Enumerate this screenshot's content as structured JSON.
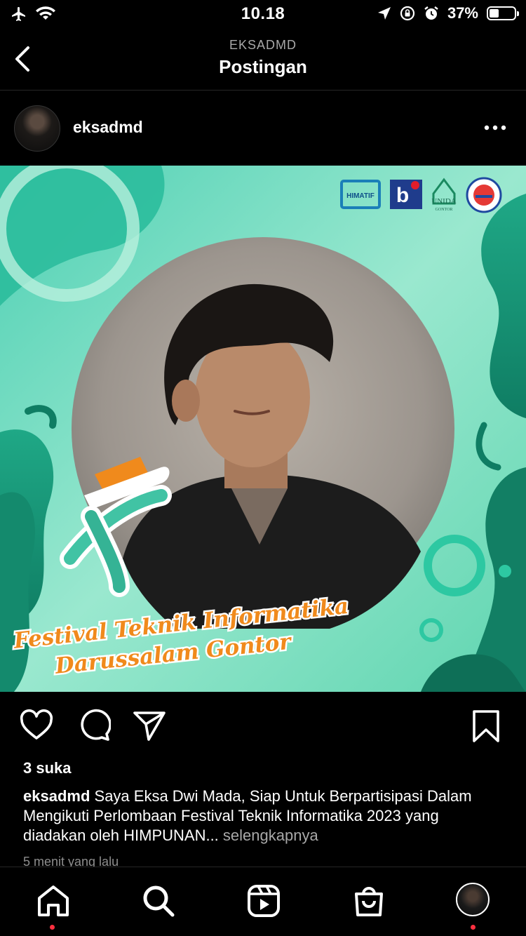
{
  "status_bar": {
    "time": "10.18",
    "battery_text": "37%",
    "icons": [
      "airplane-icon",
      "wifi-icon",
      "location-arrow-icon",
      "rotation-lock-icon",
      "alarm-icon",
      "battery-icon"
    ],
    "battery_level": 0.37
  },
  "header": {
    "subtitle": "EKSADMD",
    "title": "Postingan"
  },
  "post": {
    "username": "eksadmd",
    "image_text": {
      "logo_label": "HIMATIF",
      "unida_label": "UNIDA",
      "unida_sub": "GONTOR",
      "festival_line1": "Festival Teknik Informatika",
      "festival_line2": "Darussalam Gontor"
    },
    "likes": "3 suka",
    "caption_user": "eksadmd",
    "caption_text": "Saya Eksa Dwi Mada, Siap Untuk Berpartisipasi Dalam Mengikuti Perlombaan Festival Teknik Informatika 2023 yang diadakan oleh HIMPUNAN...",
    "more_label": "selengkapnya",
    "time_ago": "5 menit yang lalu"
  },
  "colors": {
    "background": "#000000",
    "muted": "#a8a8a8",
    "teal": "#2fb89a",
    "orange": "#f08a1c",
    "notification": "#ff3040"
  }
}
